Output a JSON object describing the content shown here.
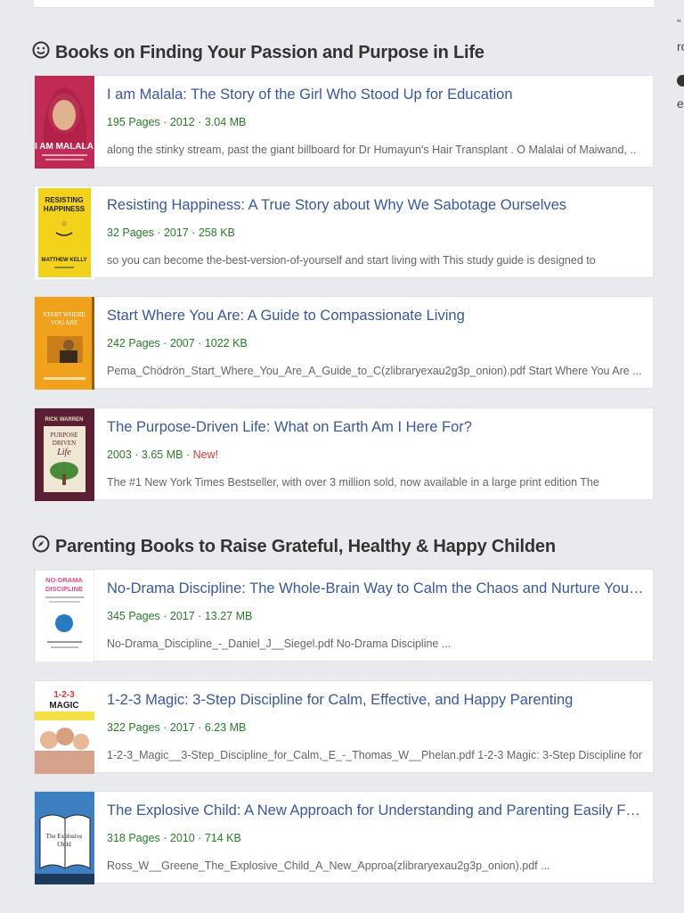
{
  "right_panel": {
    "quote_char": "“",
    "text_r": "rc",
    "text_e": "e"
  },
  "sections": [
    {
      "title": "Books on Finding Your Passion and Purpose in Life",
      "icon": "smile-icon",
      "books": [
        {
          "title": "I am Malala: The Story of the Girl Who Stood Up for Education",
          "pages": "195 Pages",
          "year": "2012",
          "size": "3.04 MB",
          "snippet": "along the stinky stream, past the giant billboard for Dr Humayun's Hair Transplant . O Malalai of Maiwand, ..",
          "cover_text": "I AM MALALA",
          "cover_bg": "#b8244a"
        },
        {
          "title": "Resisting Happiness: A True Story about Why We Sabotage Ourselves",
          "pages": "32 Pages",
          "year": "2017",
          "size": "258 KB",
          "snippet": "so you can become the-best-version-of-yourself and start living with This study guide is designed to",
          "cover_text": "RESISTING HAPPINESS",
          "cover_author": "MATTHEW KELLY",
          "cover_bg": "#f2d21a"
        },
        {
          "title": "Start Where You Are: A Guide to Compassionate Living",
          "pages": "242 Pages",
          "year": "2007",
          "size": "1022 KB",
          "snippet": "Pema_Chödrön_Start_Where_You_Are_A_Guide_to_C(zlibraryexau2g3p_onion).pdf Start Where You Are  ...",
          "cover_text": "START WHERE YOU ARE",
          "cover_bg": "#f0a21c"
        },
        {
          "title": "The Purpose-Driven Life: What on Earth Am I Here For?",
          "pages": "",
          "year": "2003",
          "size": "3.65 MB",
          "badge": "New!",
          "snippet": "The #1 New York Times Bestseller, with over 3 million sold, now available in a large print edition The",
          "cover_text": "THE PURPOSE DRIVEN Life",
          "cover_author": "RICK WARREN",
          "cover_bg": "#5a1f33"
        }
      ]
    },
    {
      "title": "Parenting Books to Raise Grateful, Healthy & Happy Childen",
      "icon": "compass-icon",
      "books": [
        {
          "title": "No-Drama Discipline: The Whole-Brain Way to Calm the Chaos and Nurture Your ...",
          "pages": "345 Pages",
          "year": "2017",
          "size": "13.27 MB",
          "snippet": "No-Drama_Discipline_-_Daniel_J__Siegel.pdf No-Drama Discipline  ...",
          "cover_text": "NO-DRAMA DISCIPLINE",
          "cover_bg": "#ffffff"
        },
        {
          "title": "1-2-3 Magic: 3-Step Discipline for Calm, Effective, and Happy Parenting",
          "pages": "322 Pages",
          "year": "2017",
          "size": "6.23 MB",
          "snippet": "1-2-3_Magic__3-Step_Discipline_for_Calm,_E_-_Thomas_W__Phelan.pdf 1-2-3 Magic: 3-Step Discipline for",
          "cover_text": "1-2-3 MAGIC",
          "cover_bg": "#f5e04a"
        },
        {
          "title": "The Explosive Child: A New Approach for Understanding and Parenting Easily Fru...",
          "pages": "318 Pages",
          "year": "2010",
          "size": "714 KB",
          "snippet": "Ross_W__Greene_The_Explosive_Child_A_New_Approa(zlibraryexau2g3p_onion).pdf  ...",
          "cover_text": "The Explosive Child",
          "cover_bg": "#3d7fc1"
        }
      ]
    }
  ],
  "colors": {
    "title_link": "#3b5998",
    "meta_green": "#2c7a2c",
    "badge_red": "#d23b3b",
    "page_bg": "#e9eaee"
  }
}
